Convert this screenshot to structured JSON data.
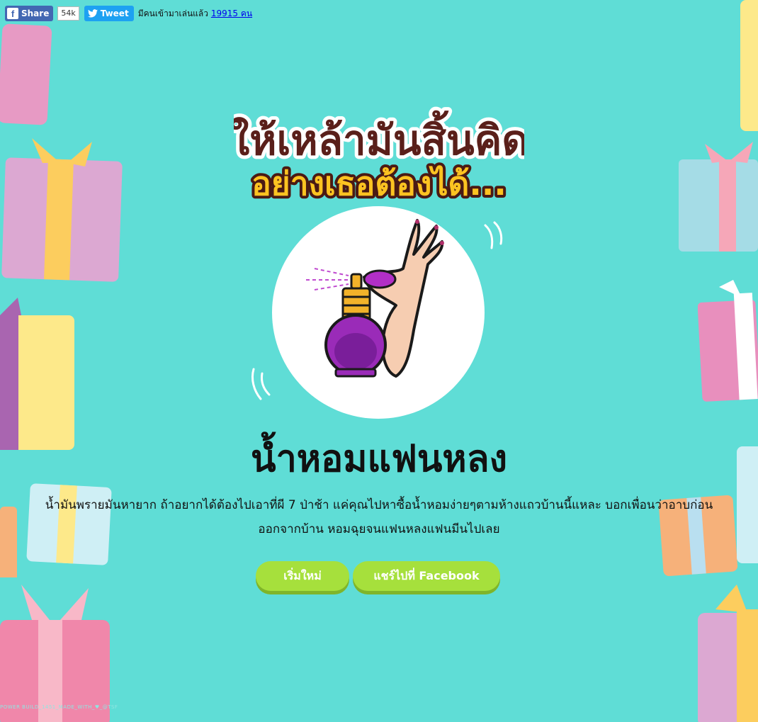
{
  "social": {
    "share_label": "Share",
    "share_count": "54k",
    "tweet_label": "Tweet",
    "players_text": "มีคนเข้ามาเล่นแล้ว",
    "players_count": "19915 คน"
  },
  "result": {
    "title": "น้ำหอมแฟนหลง",
    "description": "น้ำมันพรายมันหายาก ถ้าอยากได้ต้องไปเอาที่ผี 7 ป่าช้า แค่คุณไปหาซื้อน้ำหอมง่ายๆตามห้างแถวบ้านนี้แหละ บอกเพื่อนว่าอาบก่อนออกจากบ้าน หอมฉุยจนแฟนหลงแฟนมีนไปเลย"
  },
  "buttons": {
    "restart": "เริ่มใหม่",
    "share_facebook": "แชร์ไปที่ Facebook"
  },
  "header_image_text": {
    "line1": "ให้เหล้ามันสิ้นคิด",
    "line2": "อย่างเธอต้องได้..."
  },
  "footer": "POWER BUILD_1451_MADE_WITH_♥_@TSF",
  "colors": {
    "background": "#5fddd6",
    "button": "#a6e03c",
    "facebook": "#4267b2",
    "twitter": "#1da1f2"
  }
}
